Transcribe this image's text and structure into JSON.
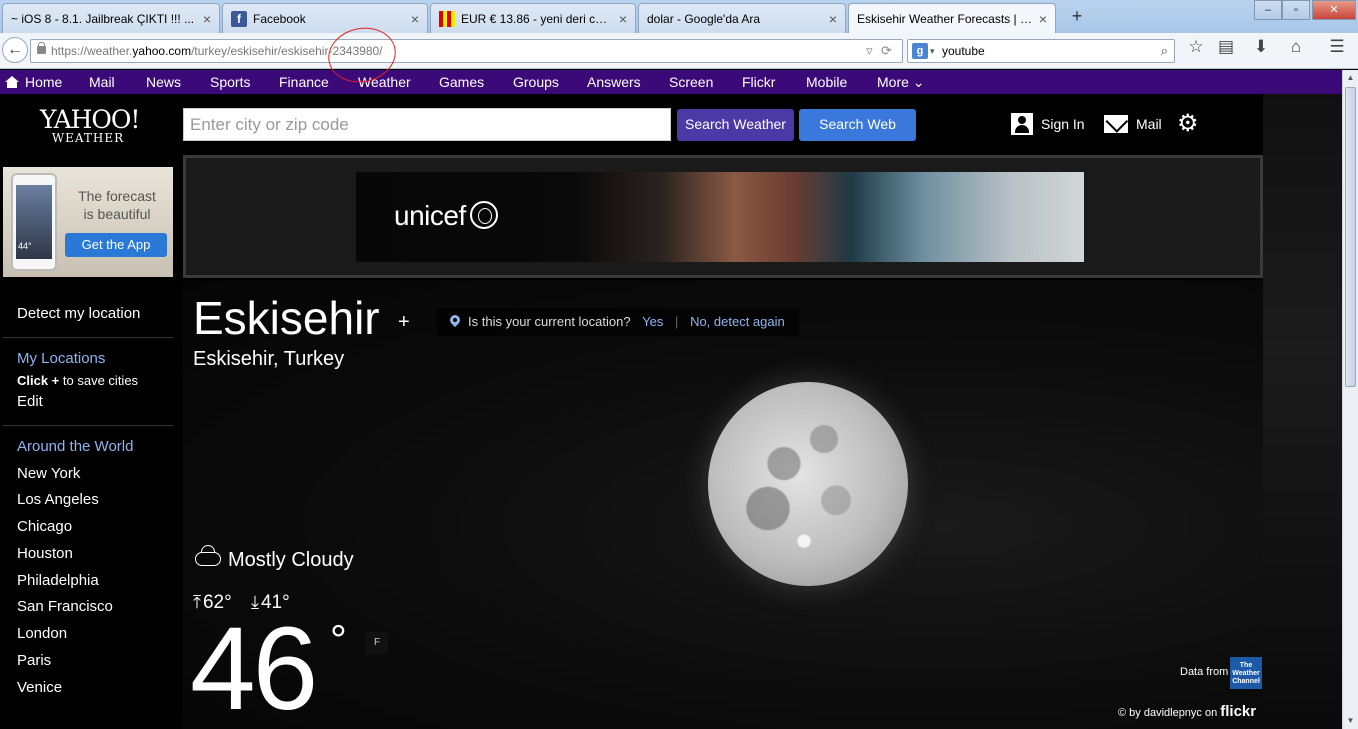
{
  "browser": {
    "tabs": [
      {
        "title": "~ iOS 8 - 8.1. Jailbreak ÇIKTI !!! ...",
        "favicon": "page-icon"
      },
      {
        "title": "Facebook",
        "favicon": "facebook-icon"
      },
      {
        "title": "EUR € 13.86 - yeni deri cüz...",
        "favicon": "flag-icon"
      },
      {
        "title": "dolar - Google'da Ara",
        "favicon": "none"
      },
      {
        "title": "Eskisehir Weather Forecasts | M...",
        "favicon": "none"
      }
    ],
    "close_glyph": "×",
    "new_tab_glyph": "+",
    "url_prefix": "https://weather.",
    "url_host": "yahoo.com",
    "url_path": "/turkey/eskisehir/eskisehir-2343980/",
    "search_value": "youtube",
    "search_engine_glyph": "g"
  },
  "yahoo_nav": {
    "items": [
      "Home",
      "Mail",
      "News",
      "Sports",
      "Finance",
      "Weather",
      "Games",
      "Groups",
      "Answers",
      "Screen",
      "Flickr",
      "Mobile",
      "More"
    ]
  },
  "header": {
    "logo_top": "YAHOO!",
    "logo_bottom": "WEATHER",
    "city_placeholder": "Enter city or zip code",
    "search_weather_label": "Search Weather",
    "search_web_label": "Search Web",
    "sign_in_label": "Sign In",
    "mail_label": "Mail"
  },
  "ads": {
    "app_ad_line1": "The forecast",
    "app_ad_line2": "is beautiful",
    "app_ad_button": "Get the App",
    "phone_temp": "44°",
    "banner_brand": "unicef"
  },
  "sidebar": {
    "detect_location": "Detect my location",
    "my_locations_heading": "My Locations",
    "click_bold": "Click +",
    "click_rest": "to save cities",
    "edit_label": "Edit",
    "around_heading": "Around the World",
    "cities": [
      "New York",
      "Los Angeles",
      "Chicago",
      "Houston",
      "Philadelphia",
      "San Francisco",
      "London",
      "Paris",
      "Venice"
    ]
  },
  "weather": {
    "city": "Eskisehir",
    "region": "Eskisehir, Turkey",
    "location_prompt": "Is this your current location?",
    "yes_label": "Yes",
    "sep": "|",
    "detect_again_label": "No, detect again",
    "condition": "Mostly Cloudy",
    "high": "62°",
    "low": "41°",
    "temperature": "46",
    "degree_glyph": "°",
    "unit": "F",
    "data_from": "Data from",
    "twc_logo_text": "The Weather Channel",
    "photo_credit": "© by davidlepnyc on",
    "flickr_label": "flickr"
  }
}
